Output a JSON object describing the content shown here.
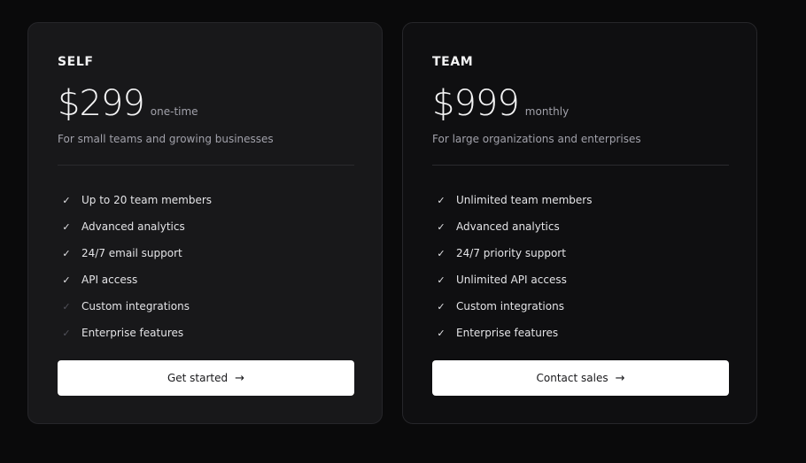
{
  "plans": [
    {
      "name": "SELF",
      "price": "$299",
      "period": "one-time",
      "description": "For small teams and growing businesses",
      "features": [
        {
          "label": "Up to 20 team members",
          "included": true
        },
        {
          "label": "Advanced analytics",
          "included": true
        },
        {
          "label": "24/7 email support",
          "included": true
        },
        {
          "label": "API access",
          "included": true
        },
        {
          "label": "Custom integrations",
          "included": false
        },
        {
          "label": "Enterprise features",
          "included": false
        }
      ],
      "cta_label": "Get started",
      "cta_icon": "arrow-right-icon"
    },
    {
      "name": "TEAM",
      "price": "$999",
      "period": "monthly",
      "description": "For large organizations and enterprises",
      "features": [
        {
          "label": "Unlimited team members",
          "included": true
        },
        {
          "label": "Advanced analytics",
          "included": true
        },
        {
          "label": "24/7 priority support",
          "included": true
        },
        {
          "label": "Unlimited API access",
          "included": true
        },
        {
          "label": "Custom integrations",
          "included": true
        },
        {
          "label": "Enterprise features",
          "included": true
        }
      ],
      "cta_label": "Contact sales",
      "cta_icon": "arrow-right-icon"
    }
  ],
  "colors": {
    "page_background": "#0a0a0b",
    "card_background_self": "#18181a",
    "card_background_team": "#0f0f11",
    "button_background": "#ffffff",
    "included_check": "#e4e4e7",
    "excluded_check": "#52525b"
  }
}
